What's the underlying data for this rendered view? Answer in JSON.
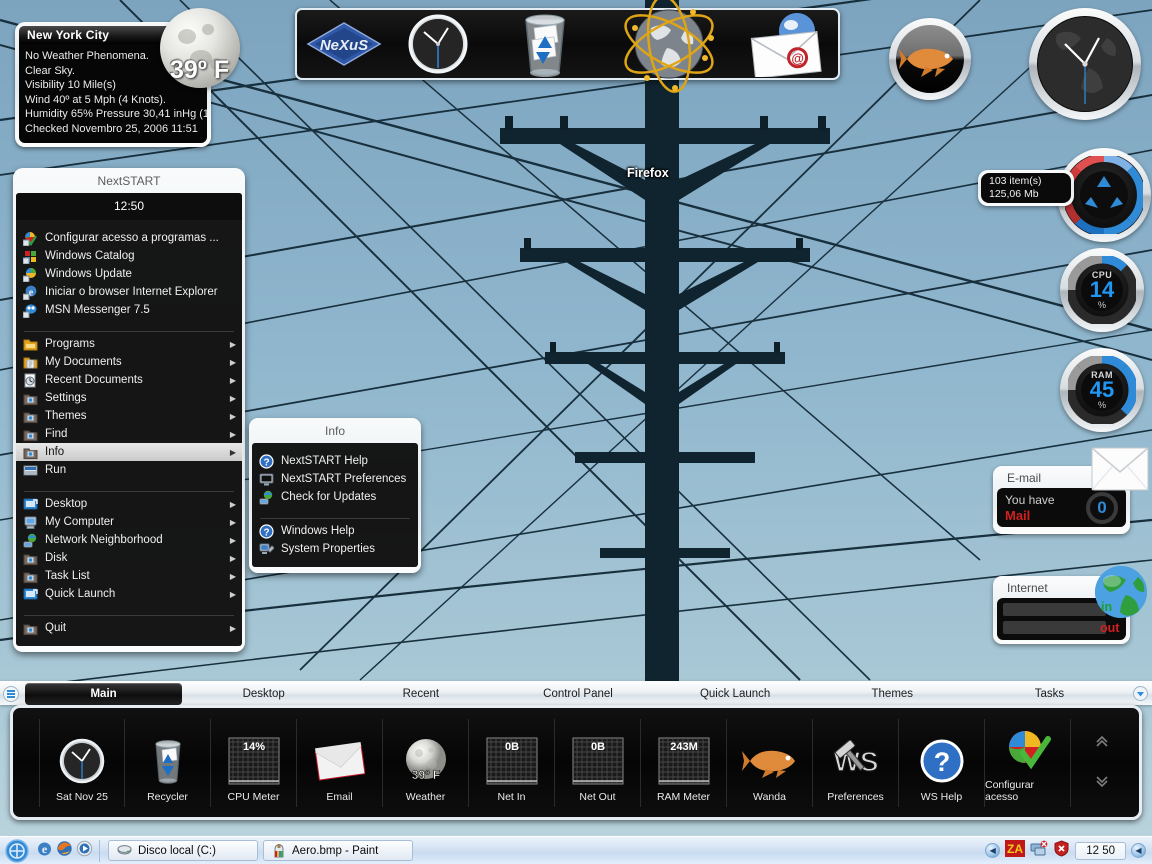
{
  "desktop": {
    "icon_label": "Firefox",
    "sky_color": "#8fb6cd"
  },
  "weather": {
    "city": "New York City",
    "temperature": "39º F",
    "lines": [
      "No Weather Phenomena.",
      "Clear Sky.",
      "Visibility 10 Mile(s)",
      "Wind 40º at 5 Mph (4 Knots).",
      "Humidity 65%  Pressure 30,41 inHg (1.",
      "Checked Novembro 25, 2006 11:51"
    ]
  },
  "start_menu": {
    "title": "NextSTART",
    "clock": "12:50",
    "group1": [
      {
        "label": "Configurar acesso a programas ...",
        "icon": "program-access-icon",
        "arrow": false
      },
      {
        "label": "Windows Catalog",
        "icon": "windows-catalog-icon",
        "arrow": false
      },
      {
        "label": "Windows Update",
        "icon": "windows-update-icon",
        "arrow": false
      },
      {
        "label": "Iniciar o browser Internet Explorer",
        "icon": "internet-explorer-icon",
        "arrow": false
      },
      {
        "label": "MSN Messenger 7.5",
        "icon": "msn-messenger-icon",
        "arrow": false
      }
    ],
    "group2": [
      {
        "label": "Programs",
        "icon": "folder-programs-icon",
        "arrow": true,
        "selected": false
      },
      {
        "label": "My Documents",
        "icon": "folder-documents-icon",
        "arrow": true,
        "selected": false
      },
      {
        "label": "Recent Documents",
        "icon": "recent-documents-icon",
        "arrow": true,
        "selected": false
      },
      {
        "label": "Settings",
        "icon": "settings-icon",
        "arrow": true,
        "selected": false
      },
      {
        "label": "Themes",
        "icon": "themes-icon",
        "arrow": true,
        "selected": false
      },
      {
        "label": "Find",
        "icon": "find-icon",
        "arrow": true,
        "selected": false
      },
      {
        "label": "Info",
        "icon": "info-folder-icon",
        "arrow": true,
        "selected": true
      },
      {
        "label": "Run",
        "icon": "run-icon",
        "arrow": false,
        "selected": false
      }
    ],
    "group3": [
      {
        "label": "Desktop",
        "icon": "desktop-icon",
        "arrow": true
      },
      {
        "label": "My Computer",
        "icon": "my-computer-icon",
        "arrow": true
      },
      {
        "label": "Network Neighborhood",
        "icon": "network-icon",
        "arrow": true
      },
      {
        "label": "Disk",
        "icon": "disk-icon",
        "arrow": true
      },
      {
        "label": "Task List",
        "icon": "task-list-icon",
        "arrow": true
      },
      {
        "label": "Quick Launch",
        "icon": "quick-launch-icon",
        "arrow": true
      }
    ],
    "group4": [
      {
        "label": "Quit",
        "icon": "quit-icon",
        "arrow": true
      }
    ]
  },
  "info_menu": {
    "title": "Info",
    "group1": [
      {
        "label": "NextSTART Help",
        "icon": "help-question-icon"
      },
      {
        "label": "NextSTART Preferences",
        "icon": "preferences-monitor-icon"
      },
      {
        "label": "Check for Updates",
        "icon": "check-updates-icon"
      }
    ],
    "group2": [
      {
        "label": "Windows Help",
        "icon": "windows-help-icon"
      },
      {
        "label": "System Properties",
        "icon": "system-properties-icon"
      }
    ]
  },
  "nexus_dock": {
    "brand": "NeXuS",
    "items": [
      {
        "name": "nexus-logo-icon"
      },
      {
        "name": "analog-clock-icon"
      },
      {
        "name": "recycle-bin-icon"
      },
      {
        "name": "network-globe-icon"
      },
      {
        "name": "email-envelope-icon"
      }
    ]
  },
  "widgets": {
    "wanda_fish": {
      "name": "wanda-fish-widget"
    },
    "world_clock": {
      "name": "world-clock-widget"
    },
    "recycler": {
      "name": "recycler-meter-widget",
      "items": "103 item(s)",
      "size": "125,06 Mb"
    },
    "cpu": {
      "label": "CPU",
      "value": "14",
      "unit": "%"
    },
    "ram": {
      "label": "RAM",
      "value": "45",
      "unit": "%"
    },
    "email": {
      "caption": "E-mail",
      "line1": "You have",
      "line2": "Mail",
      "count": "0"
    },
    "internet": {
      "caption": "Internet",
      "in_label": "in",
      "out_label": "out"
    }
  },
  "tabbar": {
    "menu_icon": "hamburger-menu-icon",
    "chevron_icon": "chevron-down-icon",
    "tabs": [
      {
        "label": "Main",
        "active": true
      },
      {
        "label": "Desktop",
        "active": false
      },
      {
        "label": "Recent",
        "active": false
      },
      {
        "label": "Control Panel",
        "active": false
      },
      {
        "label": "Quick Launch",
        "active": false
      },
      {
        "label": "Themes",
        "active": false
      },
      {
        "label": "Tasks",
        "active": false
      }
    ]
  },
  "dock": {
    "items": [
      {
        "label": "Sat Nov 25",
        "icon": "clock-icon",
        "value": ""
      },
      {
        "label": "Recycler",
        "icon": "recycle-bin-icon",
        "value": ""
      },
      {
        "label": "CPU Meter",
        "icon": "cpu-graph-icon",
        "value": "14%"
      },
      {
        "label": "Email",
        "icon": "envelope-icon",
        "value": ""
      },
      {
        "label": "Weather",
        "icon": "moon-icon",
        "value": "39º F"
      },
      {
        "label": "Net In",
        "icon": "net-graph-icon",
        "value": "0B"
      },
      {
        "label": "Net Out",
        "icon": "net-graph-icon",
        "value": "0B"
      },
      {
        "label": "RAM Meter",
        "icon": "ram-graph-icon",
        "value": "243M"
      },
      {
        "label": "Wanda",
        "icon": "wanda-fish-icon",
        "value": ""
      },
      {
        "label": "Preferences",
        "icon": "ws-hammer-icon",
        "value": ""
      },
      {
        "label": "WS Help",
        "icon": "help-question-icon",
        "value": ""
      },
      {
        "label": "Configurar acesso",
        "icon": "program-access-icon",
        "value": ""
      }
    ],
    "scroll_up_icon": "scroll-up-icon",
    "scroll_down_icon": "scroll-down-icon"
  },
  "taskbar": {
    "start_icon": "start-orb-icon",
    "quicklaunch": [
      {
        "name": "internet-explorer-icon"
      },
      {
        "name": "firefox-icon"
      },
      {
        "name": "media-player-icon"
      }
    ],
    "buttons": [
      {
        "label": "Disco local (C:)",
        "icon": "drive-icon"
      },
      {
        "label": "Aero.bmp - Paint",
        "icon": "paint-icon"
      }
    ],
    "tray": {
      "expand_icon": "tray-expand-icon",
      "icons": [
        {
          "name": "zonealarm-icon"
        },
        {
          "name": "network-connection-icon"
        },
        {
          "name": "security-shield-icon"
        }
      ],
      "clock": "12 50",
      "show_desktop_icon": "show-desktop-icon"
    }
  }
}
